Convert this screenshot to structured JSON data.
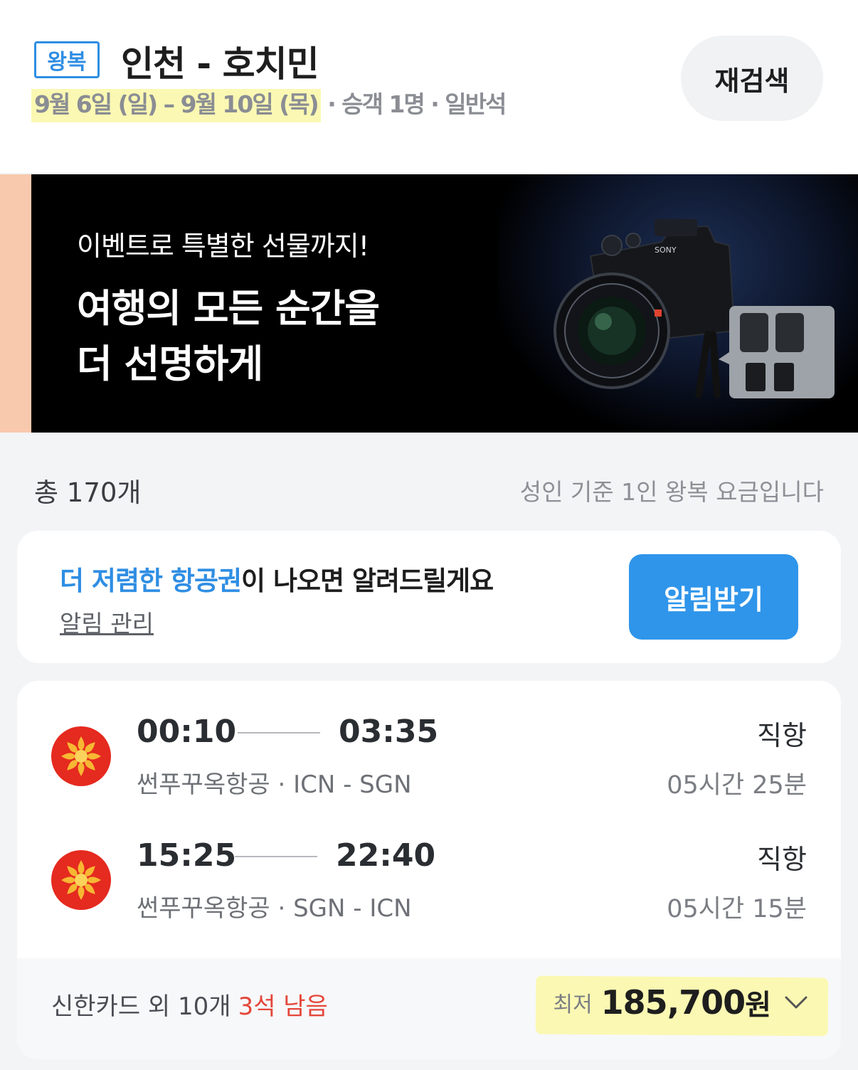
{
  "header": {
    "trip_type": "왕복",
    "route": "인천 - 호치민",
    "dates": "9월 6일 (일) – 9월 10일 (목)",
    "details": " · 승객 1명 · 일반석",
    "research_label": "재검색"
  },
  "banner": {
    "subtitle": "이벤트로 특별한 선물까지!",
    "headline_line1": "여행의 모든 순간을",
    "headline_line2": "더 선명하게",
    "product_brand": "SONY"
  },
  "results": {
    "count": "총 170개",
    "fare_note": "성인 기준 1인 왕복 요금입니다"
  },
  "alert": {
    "highlight": "더 저렴한 항공권",
    "message": "이 나오면 알려드릴게요",
    "manage_link": "알림 관리",
    "button_label": "알림받기"
  },
  "flight": {
    "outbound": {
      "departure": "00:10",
      "arrival": "03:35",
      "info": "썬푸꾸옥항공 · ICN - SGN",
      "type": "직항",
      "duration": "05시간 25분"
    },
    "inbound": {
      "departure": "15:25",
      "arrival": "22:40",
      "info": "썬푸꾸옥항공 · SGN - ICN",
      "type": "직항",
      "duration": "05시간 15분"
    },
    "footer": {
      "benefits": "신한카드 외 10개",
      "seats_left": "3석 남음",
      "price_label": "최저",
      "price": "185,700",
      "price_unit": "원"
    }
  },
  "colors": {
    "accent": "#2f8ee3",
    "button": "#2f95ea",
    "warning": "#e4473a",
    "airline_logo": "#e52a1f",
    "highlight": "#fbf8b3"
  },
  "icons": {
    "airline": "sun-logo-icon",
    "expand": "chevron-down-icon"
  }
}
